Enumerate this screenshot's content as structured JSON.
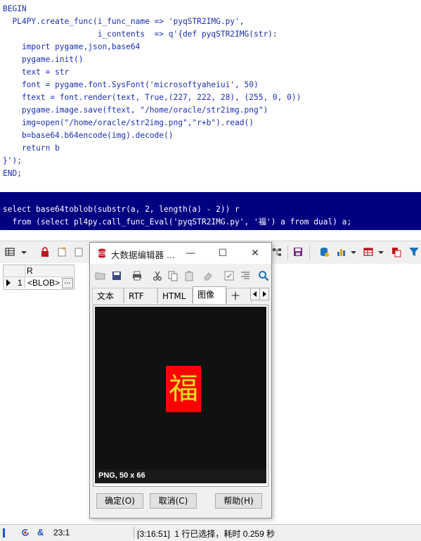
{
  "editor": {
    "lines": [
      "BEGIN",
      "  PL4PY.create_func(i_func_name => 'pyqSTR2IMG.py',",
      "                    i_contents  => q'{def pyqSTR2IMG(str):",
      "    import pygame,json,base64",
      "    pygame.init()",
      "    text = str",
      "    font = pygame.font.SysFont('microsoftyaheiui', 50)",
      "    ftext = font.render(text, True,(227, 222, 28), (255, 0, 0))",
      "    pygame.image.save(ftext, \"/home/oracle/str2img.png\")",
      "    img=open(\"/home/oracle/str2img.png\",\"r+b\").read()",
      "    b=base64.b64encode(img).decode()",
      "    return b",
      "}');",
      "END;"
    ],
    "selected_lines": [
      "select base64toblob(substr(a, 2, length(a) - 2)) r",
      "  from (select pl4py.call_func_Eval('pyqSTR2IMG.py', '福') a from dual) a;"
    ]
  },
  "grid": {
    "column_header": "R",
    "row_number": "1",
    "cell_value": "<BLOB>",
    "cell_button": "…"
  },
  "dialog": {
    "title": "大数据编辑器 ...",
    "tabs": [
      "文本",
      "RTF",
      "HTML",
      "图像",
      "十六"
    ],
    "active_tab": "图像",
    "image_char": "福",
    "image_info": "PNG, 50 x 66",
    "buttons": {
      "ok": "确定(O)",
      "cancel": "取消(C)",
      "help": "帮助(H)"
    },
    "win_minimize": "—",
    "win_maximize": "☐",
    "win_close": "✕"
  },
  "statusbar": {
    "position": "23:1",
    "message": "[3:16:51]  1 行已选择，耗时 0.259 秒"
  },
  "colors": {
    "selection_bg": "#000080",
    "image_bg": "#ff0000",
    "image_text": "#e3de1c"
  }
}
